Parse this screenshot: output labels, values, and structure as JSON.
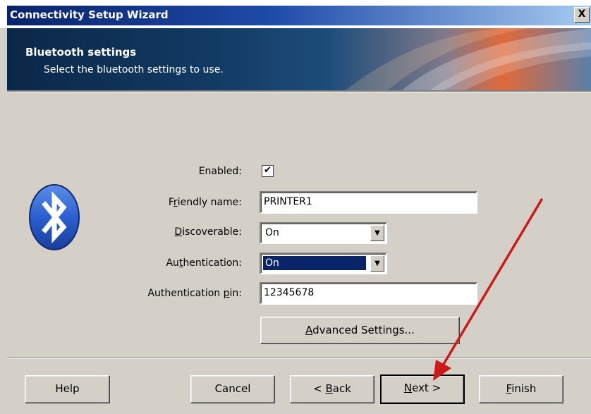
{
  "window": {
    "title": "Connectivity Setup Wizard",
    "close_label": "X"
  },
  "banner": {
    "title": "Bluetooth settings",
    "subtitle": "Select the bluetooth settings to use."
  },
  "form": {
    "enabled_label": "Enabled:",
    "enabled_checked": true,
    "enabled_mark": "✔",
    "friendly_name_label_pre": "F",
    "friendly_name_label_u": "r",
    "friendly_name_label_post": "iendly name:",
    "friendly_name_value": "PRINTER1",
    "discoverable_label_u": "D",
    "discoverable_label_post": "iscoverable:",
    "discoverable_value": "On",
    "authentication_label_pre": "Au",
    "authentication_label_u": "t",
    "authentication_label_post": "hentication:",
    "authentication_value": "On",
    "auth_pin_label_pre": "Authentication ",
    "auth_pin_label_u": "p",
    "auth_pin_label_post": "in:",
    "auth_pin_value": "12345678",
    "advanced_pre": "",
    "advanced_u": "A",
    "advanced_post": "dvanced Settings..."
  },
  "footer": {
    "help": "Help",
    "cancel": "Cancel",
    "back_pre": "< ",
    "back_u": "B",
    "back_post": "ack",
    "next_u": "N",
    "next_post": "ext >",
    "finish_u": "F",
    "finish_post": "inish"
  },
  "colors": {
    "selection": "#0a246a",
    "annotation_arrow": "#cc1a1a"
  },
  "icons": {
    "logo": "bluetooth-icon",
    "dropdown": "chevron-down-icon"
  }
}
